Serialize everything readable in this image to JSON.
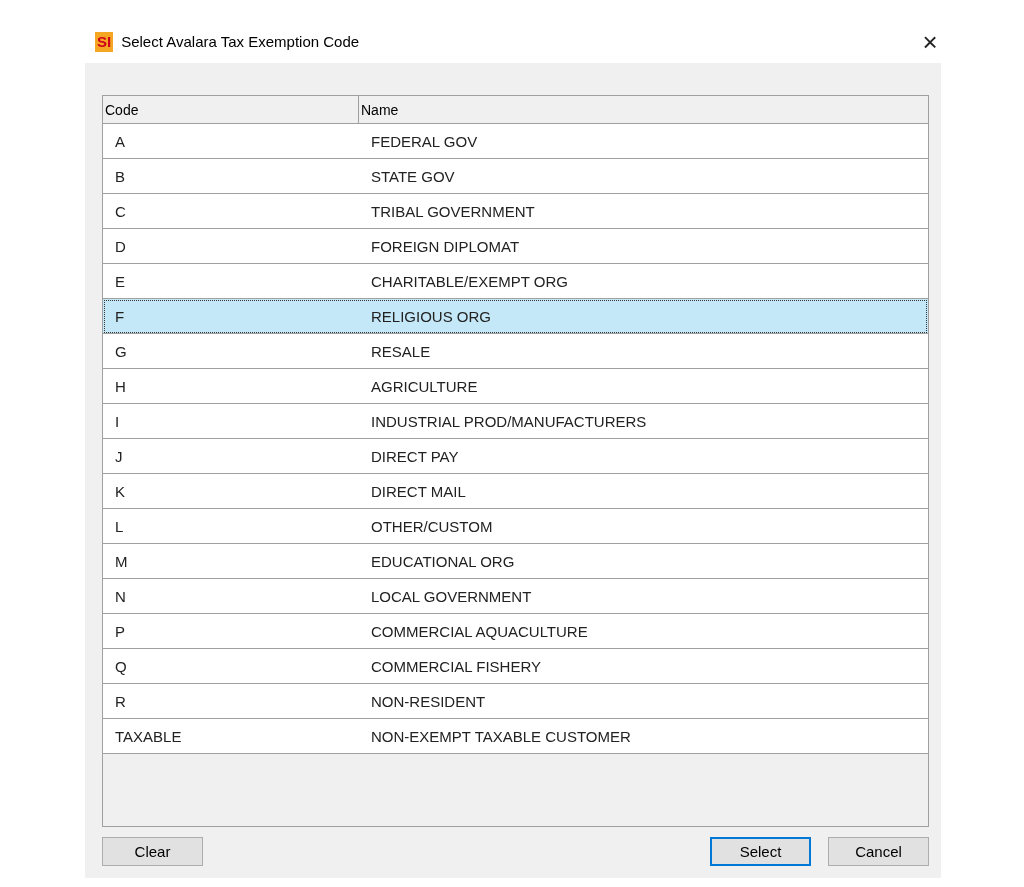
{
  "window": {
    "app_badge": "SI",
    "title": "Select Avalara Tax Exemption Code",
    "close": "×"
  },
  "table": {
    "columns": [
      "Code",
      "Name"
    ],
    "rows": [
      {
        "code": "A",
        "name": "FEDERAL GOV",
        "selected": false
      },
      {
        "code": "B",
        "name": "STATE GOV",
        "selected": false
      },
      {
        "code": "C",
        "name": "TRIBAL GOVERNMENT",
        "selected": false
      },
      {
        "code": "D",
        "name": "FOREIGN DIPLOMAT",
        "selected": false
      },
      {
        "code": "E",
        "name": "CHARITABLE/EXEMPT ORG",
        "selected": false
      },
      {
        "code": "F",
        "name": "RELIGIOUS ORG",
        "selected": true
      },
      {
        "code": "G",
        "name": "RESALE",
        "selected": false
      },
      {
        "code": "H",
        "name": "AGRICULTURE",
        "selected": false
      },
      {
        "code": "I",
        "name": "INDUSTRIAL PROD/MANUFACTURERS",
        "selected": false
      },
      {
        "code": "J",
        "name": "DIRECT PAY",
        "selected": false
      },
      {
        "code": "K",
        "name": "DIRECT MAIL",
        "selected": false
      },
      {
        "code": "L",
        "name": "OTHER/CUSTOM",
        "selected": false
      },
      {
        "code": "M",
        "name": "EDUCATIONAL ORG",
        "selected": false
      },
      {
        "code": "N",
        "name": "LOCAL GOVERNMENT",
        "selected": false
      },
      {
        "code": "P",
        "name": "COMMERCIAL AQUACULTURE",
        "selected": false
      },
      {
        "code": "Q",
        "name": "COMMERCIAL FISHERY",
        "selected": false
      },
      {
        "code": "R",
        "name": "NON-RESIDENT",
        "selected": false
      },
      {
        "code": "TAXABLE",
        "name": "NON-EXEMPT TAXABLE CUSTOMER",
        "selected": false
      }
    ]
  },
  "left_buttons": [
    {
      "label": "Clear",
      "default": false
    }
  ],
  "right_buttons": [
    {
      "label": "Select",
      "default": true
    },
    {
      "label": "Cancel",
      "default": false
    }
  ]
}
